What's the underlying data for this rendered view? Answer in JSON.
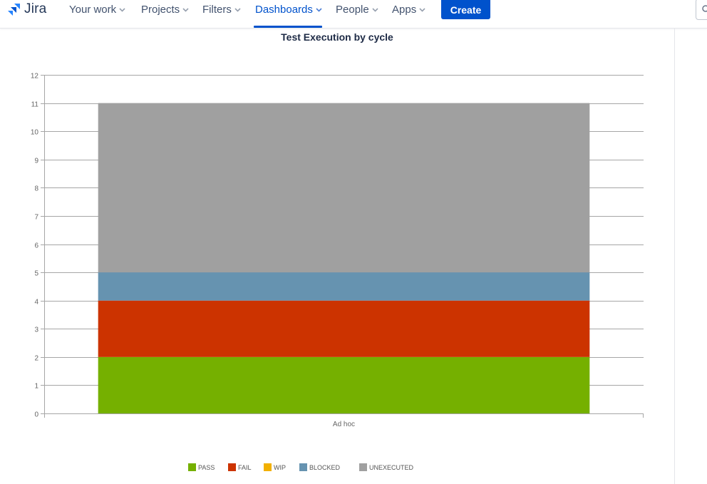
{
  "app": {
    "name": "Jira"
  },
  "nav": {
    "items": [
      {
        "label": "Your work",
        "active": false
      },
      {
        "label": "Projects",
        "active": false
      },
      {
        "label": "Filters",
        "active": false
      },
      {
        "label": "Dashboards",
        "active": true
      },
      {
        "label": "People",
        "active": false
      },
      {
        "label": "Apps",
        "active": false
      }
    ],
    "create_label": "Create"
  },
  "colors": {
    "accent": "#0052cc",
    "pass": "#75b000",
    "fail": "#cc3300",
    "wip": "#f2b000",
    "blocked": "#6693b0",
    "unexecuted": "#a0a0a0"
  },
  "chart_data": {
    "type": "bar",
    "stacked": true,
    "title": "Test Execution by cycle",
    "categories": [
      "Ad hoc"
    ],
    "series": [
      {
        "name": "PASS",
        "values": [
          2
        ],
        "color": "#75b000"
      },
      {
        "name": "FAIL",
        "values": [
          2
        ],
        "color": "#cc3300"
      },
      {
        "name": "WIP",
        "values": [
          0
        ],
        "color": "#f2b000"
      },
      {
        "name": "BLOCKED",
        "values": [
          1
        ],
        "color": "#6693b0"
      },
      {
        "name": "UNEXECUTED",
        "values": [
          6
        ],
        "color": "#a0a0a0"
      }
    ],
    "ylim": [
      0,
      12
    ],
    "yticks": [
      "0",
      "1",
      "2",
      "3",
      "4",
      "5",
      "6",
      "7",
      "8",
      "9",
      "10",
      "11",
      "12"
    ],
    "grid": true,
    "legend_position": "bottom"
  }
}
